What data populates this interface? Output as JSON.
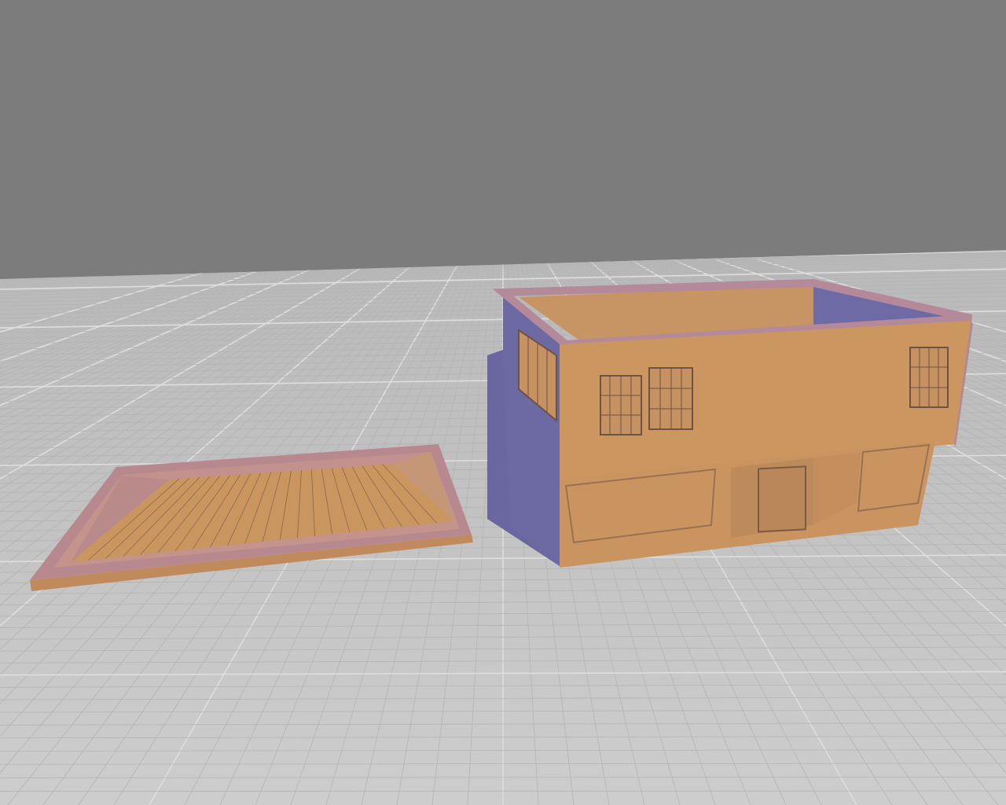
{
  "viewport": {
    "background_color": "#7b7b7b",
    "floor_color": "#c9c9c9",
    "grid_minor_color": "#b4b4b4",
    "grid_major_color": "#dedede"
  },
  "models": {
    "roof_piece": {
      "icon": "roof-panel-model",
      "face_color": "#c9965f",
      "shade_color": "#b88a8a",
      "rim_color": "#c08d62"
    },
    "building_piece": {
      "icon": "building-shell-model",
      "front_color": "#c9945f",
      "side_color": "#6a66a0",
      "rim_color": "#b68a95"
    }
  }
}
